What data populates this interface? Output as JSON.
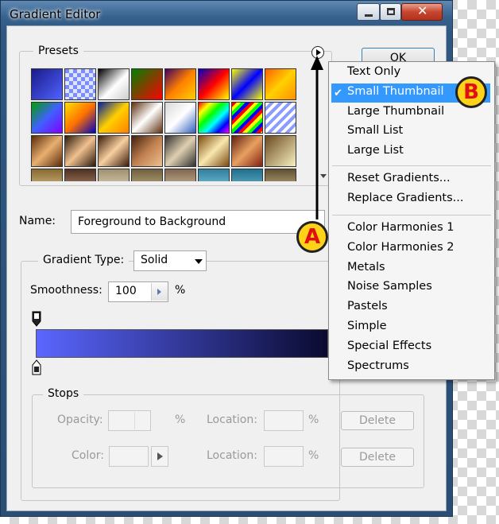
{
  "window": {
    "title": "Gradient Editor"
  },
  "presets": {
    "label": "Presets",
    "swatches": [
      "linear-gradient(135deg,#1a1a8a,#4f63ff)",
      "repeating-conic-gradient(#dfe4ff 0% 25%,#7b8cff 0% 50%)",
      "linear-gradient(135deg,#000,#fff 55%,#ccc)",
      "linear-gradient(135deg,#008000,#ff0000)",
      "linear-gradient(135deg,#400060,#ff8000,#ffd000)",
      "linear-gradient(135deg,#0000c0,#ff0000,#ffff00)",
      "linear-gradient(135deg,#ffff00,#0000ff,#ffff00)",
      "linear-gradient(135deg,#ff6000,#ffd000,#ff9000)",
      "linear-gradient(135deg,#00a000,#4060ff,#8000ff)",
      "linear-gradient(135deg,#ffe000,#ff7000,#0000c0)",
      "linear-gradient(135deg,#0020a0,#ffd000,#ff8000)",
      "linear-gradient(135deg,#603010,#fff,#603010)",
      "linear-gradient(135deg,#d8d8d8,#fff,#3060c0)",
      "linear-gradient(135deg,#ff0000,#ffff00,#00ff00,#00ffff,#0000ff,#ff00ff)",
      "repeating-linear-gradient(135deg,#ff0000 0 4px,#ffff00 4px 8px,#00ff00 8px 12px,#0000ff 12px 16px)",
      "repeating-linear-gradient(135deg,#fff 0 4px,#8a9cff 4px 8px)",
      "linear-gradient(135deg,#5a2a0a,#e8b070,#5a2a0a)",
      "linear-gradient(135deg,#2a1a0a,#f0c090,#2a1a0a)",
      "linear-gradient(135deg,#3a1a0a,#f8d0a0,#3a1a0a)",
      "linear-gradient(135deg,#402010,#c08050,#f0c090)",
      "linear-gradient(135deg,#303030,#e0d0b0,#303030)",
      "linear-gradient(135deg,#7a4a10,#f8e8b0,#7a4a10)",
      "linear-gradient(135deg,#602010,#e8a060,#802010)",
      "linear-gradient(135deg,#6a4a20,#f8f0c0)",
      "linear-gradient(180deg,#8a6a30,#f0e0b0)",
      "linear-gradient(180deg,#503020,#d0b090)",
      "linear-gradient(180deg,#a09070,#f8f0d8)",
      "linear-gradient(180deg,#706040,#e0d0a0)",
      "linear-gradient(180deg,#806850,#f0e0c0)",
      "linear-gradient(180deg,#3080a0,#a0e0f0)",
      "linear-gradient(180deg,#207090,#90d0e0)",
      "linear-gradient(180deg,#605030,#e8d8a8)"
    ]
  },
  "buttons": {
    "ok": "OK"
  },
  "name": {
    "label": "Name:",
    "value": "Foreground to Background"
  },
  "gradient_type": {
    "label": "Gradient Type:",
    "value": "Solid"
  },
  "smoothness": {
    "label": "Smoothness:",
    "value": "100",
    "unit": "%"
  },
  "gradient_bar": {
    "color_start": "#5a66ff",
    "color_end": "#0a0a30"
  },
  "stops": {
    "label": "Stops",
    "opacity_label": "Opacity:",
    "opacity_unit": "%",
    "location_label": "Location:",
    "location_unit": "%",
    "color_label": "Color:",
    "delete_label": "Delete"
  },
  "menu": {
    "selected_index": 1,
    "group1": [
      "Text Only",
      "Small Thumbnail",
      "Large Thumbnail",
      "Small List",
      "Large List"
    ],
    "group2": [
      "Reset Gradients...",
      "Replace Gradients..."
    ],
    "group3": [
      "Color Harmonies 1",
      "Color Harmonies 2",
      "Metals",
      "Noise Samples",
      "Pastels",
      "Simple",
      "Special Effects",
      "Spectrums"
    ]
  },
  "callouts": {
    "a": "A",
    "b": "B",
    "color_fill": "#ffd21a",
    "color_text": "#e01010"
  },
  "icons": {
    "menu_button": "circle-arrow-right-icon",
    "check": "check-icon"
  }
}
